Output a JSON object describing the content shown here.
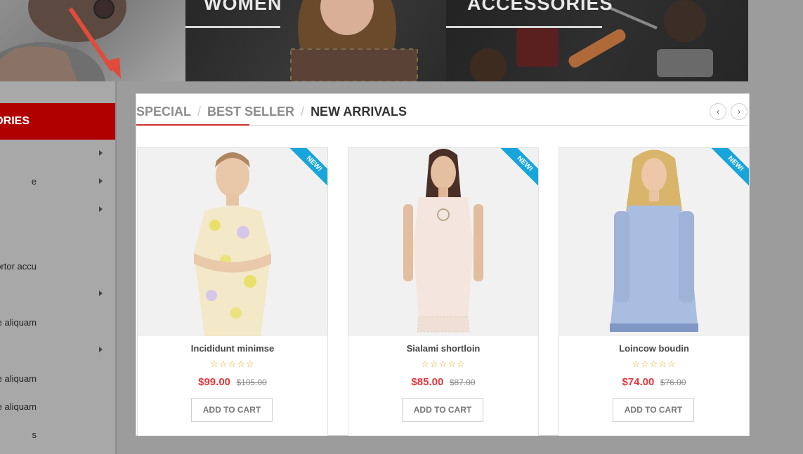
{
  "banner": {
    "women_title": "WOMEN",
    "accessories_title": "ACCESSORIES"
  },
  "sidebar": {
    "header": "ORIES",
    "items": [
      {
        "label": "",
        "has_arrow": true
      },
      {
        "label": "e",
        "has_arrow": true
      },
      {
        "label": "",
        "has_arrow": true
      },
      {
        "label": "ortor accu",
        "has_arrow": false
      },
      {
        "label": "",
        "has_arrow": true
      },
      {
        "label": "e aliquam",
        "has_arrow": false
      },
      {
        "label": "",
        "has_arrow": true
      },
      {
        "label": "e aliquam",
        "has_arrow": false
      },
      {
        "label": "e aliquam",
        "has_arrow": false
      },
      {
        "label": "s",
        "has_arrow": false
      }
    ]
  },
  "products_section": {
    "tabs": [
      {
        "label": "SPECIAL",
        "active": false
      },
      {
        "label": "BEST SELLER",
        "active": false
      },
      {
        "label": "NEW ARRIVALS",
        "active": true
      }
    ],
    "tab_separator": "/",
    "prev_icon": "‹",
    "next_icon": "›",
    "products": [
      {
        "name": "Incididunt minimse",
        "badge": "NEW!",
        "rating": "☆☆☆☆☆",
        "price": "$99.00",
        "old_price": "$105.00",
        "button": "ADD TO CART"
      },
      {
        "name": "Sialami shortloin",
        "badge": "NEW!",
        "rating": "☆☆☆☆☆",
        "price": "$85.00",
        "old_price": "$87.00",
        "button": "ADD TO CART"
      },
      {
        "name": "Loincow boudin",
        "badge": "NEW!",
        "rating": "☆☆☆☆☆",
        "price": "$74.00",
        "old_price": "$76.00",
        "button": "ADD TO CART"
      }
    ]
  },
  "colors": {
    "accent_red": "#d32f2f",
    "category_header": "#b00000",
    "price": "#e0393e",
    "badge": "#17a5db",
    "stars": "#f2a81d"
  }
}
